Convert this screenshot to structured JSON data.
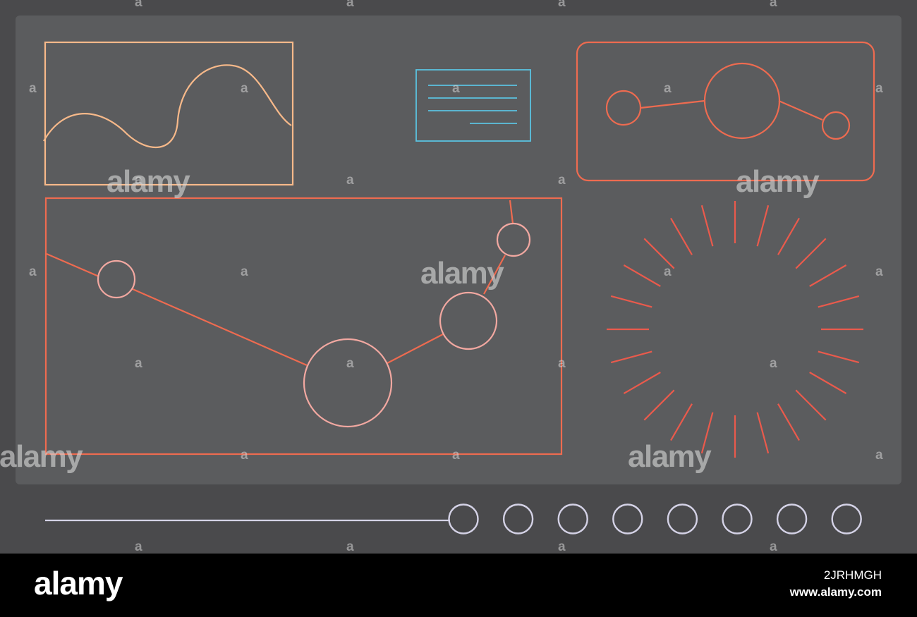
{
  "colors": {
    "frame": "#4a4a4c",
    "screen": "#5b5c5e",
    "wave_accent": "#f7b98a",
    "coral_accent": "#ee6b50",
    "pink_accent": "#f2a8a1",
    "doc_accent": "#5bc2e0",
    "slider_accent": "#d4d2e6",
    "sunburst_accent": "#ea5a4c"
  },
  "icons": [
    "sine-wave-chart",
    "text-document-card",
    "node-network-panel",
    "bubble-line-chart",
    "sunburst-dial",
    "slider-track",
    "circular-buttons"
  ],
  "navigation": {
    "dot_buttons_count": 8
  },
  "watermark": {
    "word": "alamy",
    "small_mark": "a"
  },
  "footer": {
    "logo": "alamy",
    "image_id": "2JRHMGH",
    "url": "www.alamy.com"
  }
}
